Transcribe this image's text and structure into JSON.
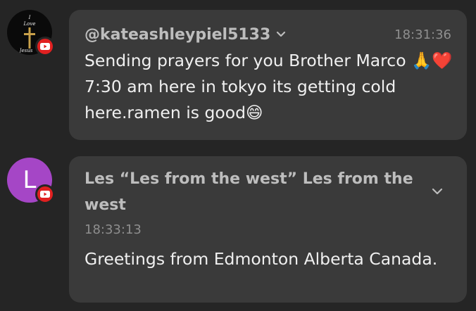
{
  "messages": [
    {
      "author": "@kateashleypiel5133",
      "timestamp": "18:31:36",
      "text": "Sending prayers for you Brother Marco 🙏❤️7:30 am here in tokyo its getting cold here.ramen is good😄",
      "avatar": {
        "logo_text_top": "I",
        "logo_text_mid": "Love",
        "logo_text_bottom": "Jesus"
      },
      "platform_badge": "youtube-icon"
    },
    {
      "author": "Les “Les from the west” Les from the west",
      "timestamp": "18:33:13",
      "text": "Greetings from Edmonton Alberta Canada.",
      "avatar": {
        "letter": "L",
        "color": "#a546c6"
      },
      "platform_badge": "youtube-icon"
    }
  ],
  "colors": {
    "background": "#252525",
    "bubble": "#3a3a3a",
    "youtube_red": "#e02020"
  }
}
